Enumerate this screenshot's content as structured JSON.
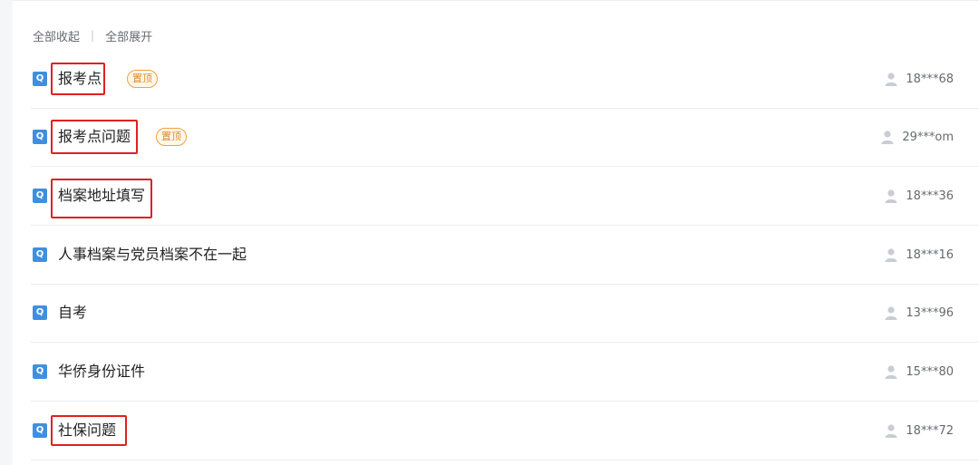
{
  "toolbar": {
    "collapse_all": "全部收起",
    "separator": "|",
    "expand_all": "全部展开"
  },
  "questions": [
    {
      "q_label": "Q",
      "title": "报考点",
      "badge": "置顶",
      "user": "18***68"
    },
    {
      "q_label": "Q",
      "title": "报考点问题",
      "badge": "置顶",
      "user": "29***om"
    },
    {
      "q_label": "Q",
      "title": "档案地址填写",
      "badge": null,
      "user": "18***36"
    },
    {
      "q_label": "Q",
      "title": "人事档案与党员档案不在一起",
      "badge": null,
      "user": "18***16"
    },
    {
      "q_label": "Q",
      "title": "自考",
      "badge": null,
      "user": "13***96"
    },
    {
      "q_label": "Q",
      "title": "华侨身份证件",
      "badge": null,
      "user": "15***80"
    },
    {
      "q_label": "Q",
      "title": "社保问题",
      "badge": null,
      "user": "18***72"
    }
  ],
  "colors": {
    "q_icon": "#3f8fe0",
    "highlight_box": "#e02020",
    "badge": "#e5892a"
  }
}
